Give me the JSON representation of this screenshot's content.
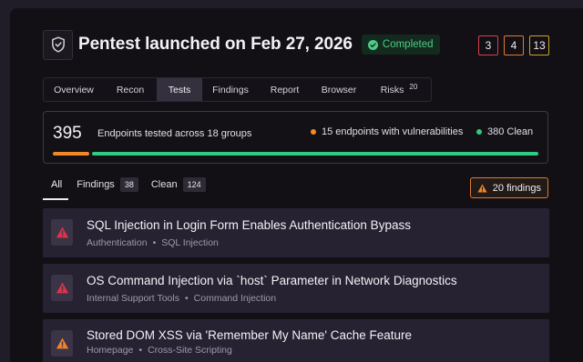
{
  "header": {
    "title": "Pentest launched on Feb 27, 2026",
    "status": "Completed",
    "status_color": "#4ecb85",
    "severity_counts": [
      {
        "level": "critical",
        "count": "3",
        "color": "#d24050"
      },
      {
        "level": "high",
        "count": "4",
        "color": "#e07a30"
      },
      {
        "level": "medium",
        "count": "13",
        "color": "#c9a22c"
      }
    ]
  },
  "tabs": [
    {
      "label": "Overview"
    },
    {
      "label": "Recon"
    },
    {
      "label": "Tests",
      "active": true
    },
    {
      "label": "Findings"
    },
    {
      "label": "Report"
    },
    {
      "label": "Browser"
    },
    {
      "label": "Risks",
      "badge": "20"
    }
  ],
  "summary": {
    "total": "395",
    "total_label": "Endpoints tested across 18 groups",
    "vulnerable_label": "15 endpoints with vulnerabilities",
    "clean_label": "380 Clean",
    "vulnerable_count": 15,
    "clean_count": 380,
    "vulnerable_color": "#f08a26",
    "clean_color": "#2ecc80"
  },
  "filters": {
    "all_label": "All",
    "findings_label": "Findings",
    "findings_count": "38",
    "clean_label": "Clean",
    "clean_count": "124",
    "findings_badge": "20 findings"
  },
  "findings": [
    {
      "title": "SQL Injection in Login Form Enables Authentication Bypass",
      "category": "Authentication",
      "type": "SQL Injection",
      "severity": "critical",
      "icon": "warning-triangle-icon",
      "color": "#e0334a"
    },
    {
      "title": "OS Command Injection via `host` Parameter in Network Diagnostics",
      "category": "Internal Support Tools",
      "type": "Command Injection",
      "severity": "critical",
      "icon": "warning-triangle-icon",
      "color": "#e0334a"
    },
    {
      "title": "Stored DOM XSS via 'Remember My Name' Cache Feature",
      "category": "Homepage",
      "type": "Cross-Site Scripting",
      "severity": "high",
      "icon": "warning-triangle-icon",
      "color": "#f0842a"
    }
  ]
}
